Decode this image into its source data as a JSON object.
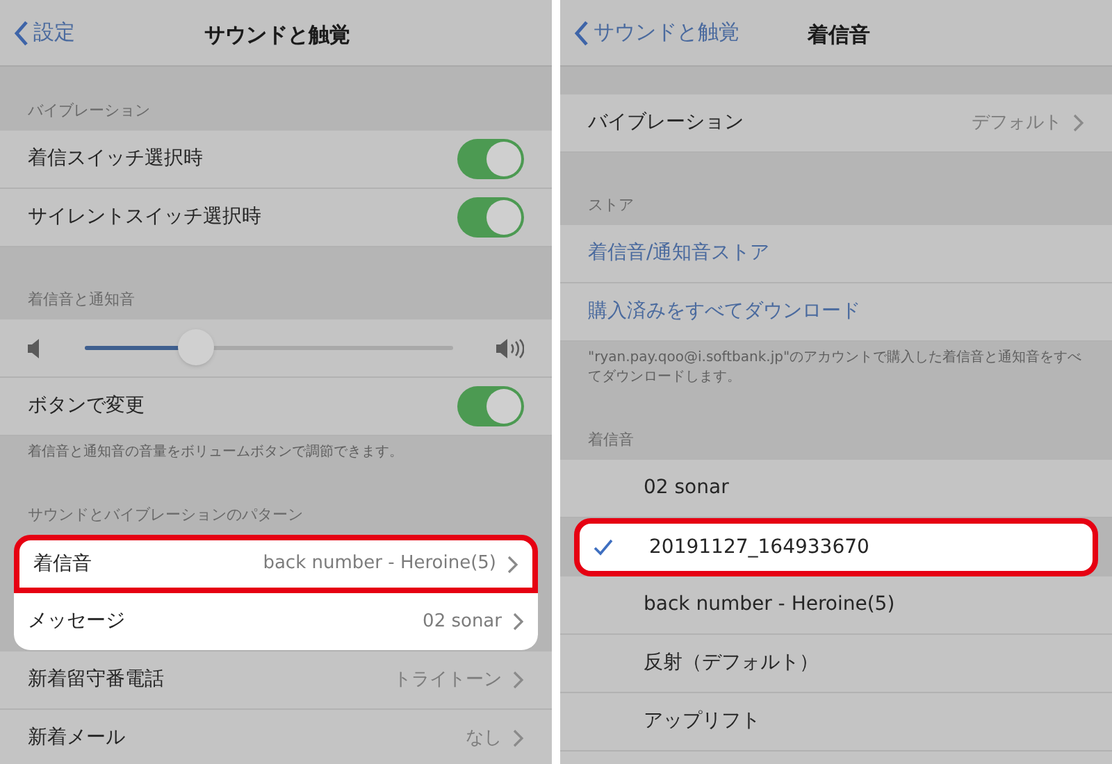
{
  "left": {
    "nav": {
      "back": "設定",
      "title": "サウンドと触覚"
    },
    "sections": [
      {
        "header": "バイブレーション",
        "rows": [
          {
            "kind": "toggle",
            "label": "着信スイッチ選択時",
            "on": true,
            "spotlight": false,
            "boxed": false
          },
          {
            "kind": "toggle",
            "label": "サイレントスイッチ選択時",
            "on": true,
            "spotlight": false,
            "boxed": false
          }
        ]
      },
      {
        "header": "着信音と通知音",
        "rows": [
          {
            "kind": "slider",
            "level": 0.3,
            "spotlight": false,
            "boxed": false
          },
          {
            "kind": "toggle",
            "label": "ボタンで変更",
            "on": true,
            "spotlight": false,
            "boxed": false
          }
        ],
        "footer": "着信音と通知音の音量をボリュームボタンで調節できます。"
      },
      {
        "header": "サウンドとバイブレーションのパターン",
        "rows": [
          {
            "kind": "link",
            "label": "着信音",
            "value": "back number - Heroine(5)",
            "spotlight": true,
            "boxed": true
          },
          {
            "kind": "link",
            "label": "メッセージ",
            "value": "02 sonar",
            "spotlight": true,
            "boxed": false
          },
          {
            "kind": "link",
            "label": "新着留守番電話",
            "value": "トライトーン",
            "spotlight": false,
            "boxed": false
          },
          {
            "kind": "link",
            "label": "新着メール",
            "value": "なし",
            "spotlight": false,
            "boxed": false
          }
        ]
      }
    ]
  },
  "right": {
    "nav": {
      "back": "サウンドと触覚",
      "title": "着信音"
    },
    "sections": [
      {
        "rows": [
          {
            "kind": "link",
            "label": "バイブレーション",
            "value": "デフォルト",
            "spotlight": false,
            "boxed": false
          }
        ]
      },
      {
        "header": "ストア",
        "rows": [
          {
            "kind": "action",
            "label": "着信音/通知音ストア",
            "spotlight": false,
            "boxed": false
          },
          {
            "kind": "action",
            "label": "購入済みをすべてダウンロード",
            "spotlight": false,
            "boxed": false
          }
        ],
        "footer": "\"ryan.pay.qoo@i.softbank.jp\"のアカウントで購入した着信音と通知音をすべてダウンロードします。"
      },
      {
        "header": "着信音",
        "rows": [
          {
            "kind": "tone",
            "label": "02 sonar",
            "selected": false,
            "spotlight": false,
            "boxed": false
          },
          {
            "kind": "tone",
            "label": "20191127_164933670",
            "selected": true,
            "spotlight": true,
            "boxed": true
          },
          {
            "kind": "tone",
            "label": "back number - Heroine(5)",
            "selected": false,
            "spotlight": false,
            "boxed": false
          }
        ]
      },
      {
        "rows": [
          {
            "kind": "tone",
            "label": "反射（デフォルト）",
            "selected": false,
            "spotlight": false,
            "boxed": false
          },
          {
            "kind": "tone",
            "label": "アップリフト",
            "selected": false,
            "spotlight": false,
            "boxed": false
          }
        ]
      }
    ]
  }
}
